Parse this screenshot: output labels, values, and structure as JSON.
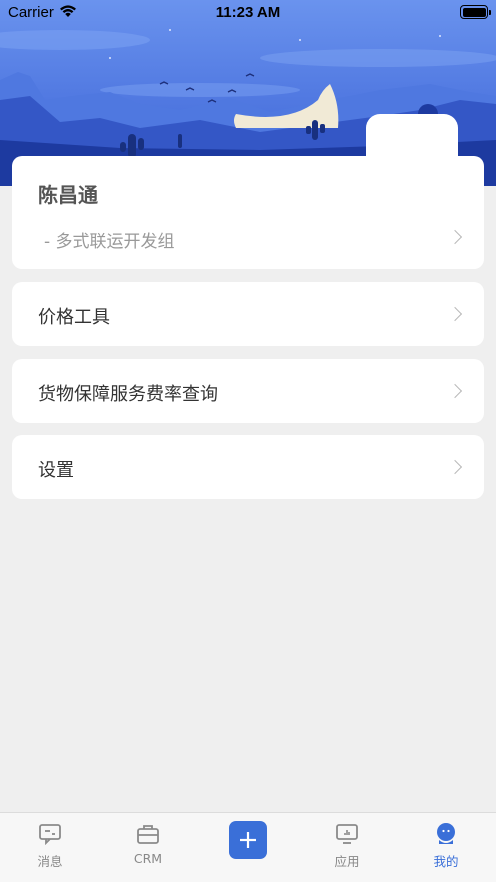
{
  "status_bar": {
    "carrier": "Carrier",
    "time": "11:23 AM"
  },
  "profile": {
    "name": "陈昌通",
    "department": "- 多式联运开发组"
  },
  "menu": {
    "items": [
      {
        "label": "价格工具"
      },
      {
        "label": "货物保障服务费率查询"
      },
      {
        "label": "设置"
      }
    ]
  },
  "tabbar": {
    "tabs": [
      {
        "label": "消息",
        "icon": "message-icon"
      },
      {
        "label": "CRM",
        "icon": "briefcase-icon"
      },
      {
        "label": "",
        "icon": "plus-icon"
      },
      {
        "label": "应用",
        "icon": "monitor-icon"
      },
      {
        "label": "我的",
        "icon": "person-icon"
      }
    ],
    "active": "我的"
  },
  "colors": {
    "accent": "#3a6fd8",
    "banner_dark": "#1d3aa0",
    "banner_light": "#5b86e8"
  }
}
